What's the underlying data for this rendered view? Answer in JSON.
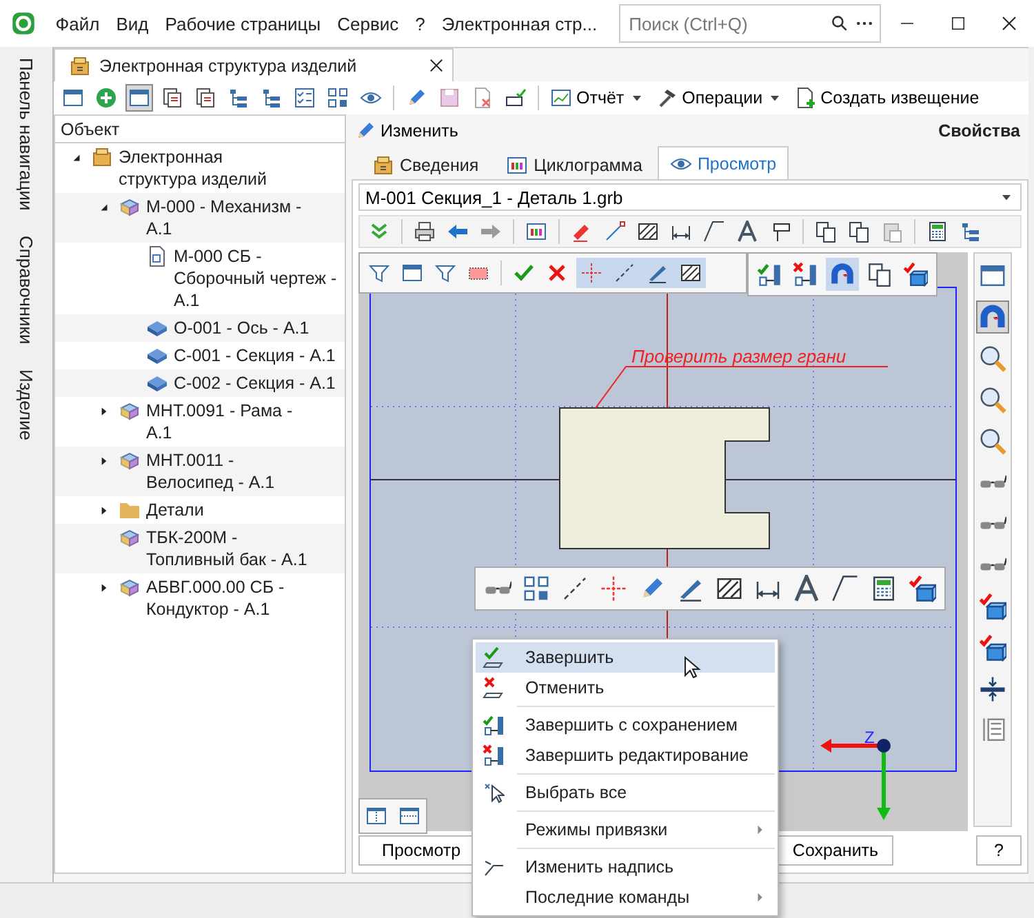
{
  "menu_bar": {
    "items": [
      "Файл",
      "Вид",
      "Рабочие страницы",
      "Сервис",
      "?"
    ],
    "title": "Электронная стр...",
    "search": {
      "placeholder": "Поиск (Ctrl+Q)"
    }
  },
  "side_panels": [
    "Панель навигации",
    "Справочники",
    "Изделие"
  ],
  "document_tab": {
    "title": "Электронная структура изделий"
  },
  "toolbar": {
    "report": "Отчёт",
    "operations": "Операции",
    "create_notice": "Создать извещение"
  },
  "tree": {
    "column": "Объект",
    "items": [
      {
        "label": "Электронная структура изделий",
        "kind": "structure",
        "expanded": true,
        "children": [
          {
            "label": "М-000 - Механизм - А.1",
            "kind": "assembly",
            "expanded": true,
            "children": [
              {
                "label": "М-000 СБ - Сборочный чертеж - А.1",
                "kind": "document"
              },
              {
                "label": "О-001 - Ось - А.1",
                "kind": "part"
              },
              {
                "label": "С-001 - Секция - А.1",
                "kind": "part"
              },
              {
                "label": "С-002 - Секция - А.1",
                "kind": "part"
              }
            ]
          },
          {
            "label": "МНТ.0091 - Рама - А.1",
            "kind": "assembly",
            "expanded": false
          },
          {
            "label": "МНТ.0011 - Велосипед - А.1",
            "kind": "assembly",
            "expanded": false
          },
          {
            "label": "Детали",
            "kind": "folder",
            "expanded": false
          },
          {
            "label": "ТБК-200М - Топливный бак - А.1",
            "kind": "assembly"
          },
          {
            "label": "АБВГ.000.00 СБ - Кондуктор - А.1",
            "kind": "assembly",
            "expanded": false
          }
        ]
      }
    ]
  },
  "properties": {
    "edit": "Изменить",
    "title": "Свойства",
    "tabs": [
      {
        "label": "Сведения",
        "selected": false
      },
      {
        "label": "Циклограмма",
        "selected": false
      },
      {
        "label": "Просмотр",
        "selected": true
      }
    ],
    "file": "M-001 Секция_1 - Деталь 1.grb"
  },
  "canvas": {
    "annotation": "Проверить размер грани",
    "axis_label": "Z"
  },
  "buttons": [
    "Просмотр",
    "Сохранить",
    "?"
  ],
  "context_menu": [
    [
      {
        "label": "Завершить",
        "highlighted": true,
        "submenu": false
      },
      {
        "label": "Отменить",
        "highlighted": false,
        "submenu": false
      }
    ],
    [
      {
        "label": "Завершить с сохранением",
        "highlighted": false,
        "submenu": false
      },
      {
        "label": "Завершить редактирование",
        "highlighted": false,
        "submenu": false
      }
    ],
    [
      {
        "label": "Выбрать все",
        "highlighted": false,
        "submenu": false
      }
    ],
    [
      {
        "label": "Режимы привязки",
        "highlighted": false,
        "submenu": true
      }
    ],
    [
      {
        "label": "Изменить надпись",
        "highlighted": false,
        "submenu": false
      },
      {
        "label": "Последние команды",
        "highlighted": false,
        "submenu": true
      }
    ]
  ]
}
